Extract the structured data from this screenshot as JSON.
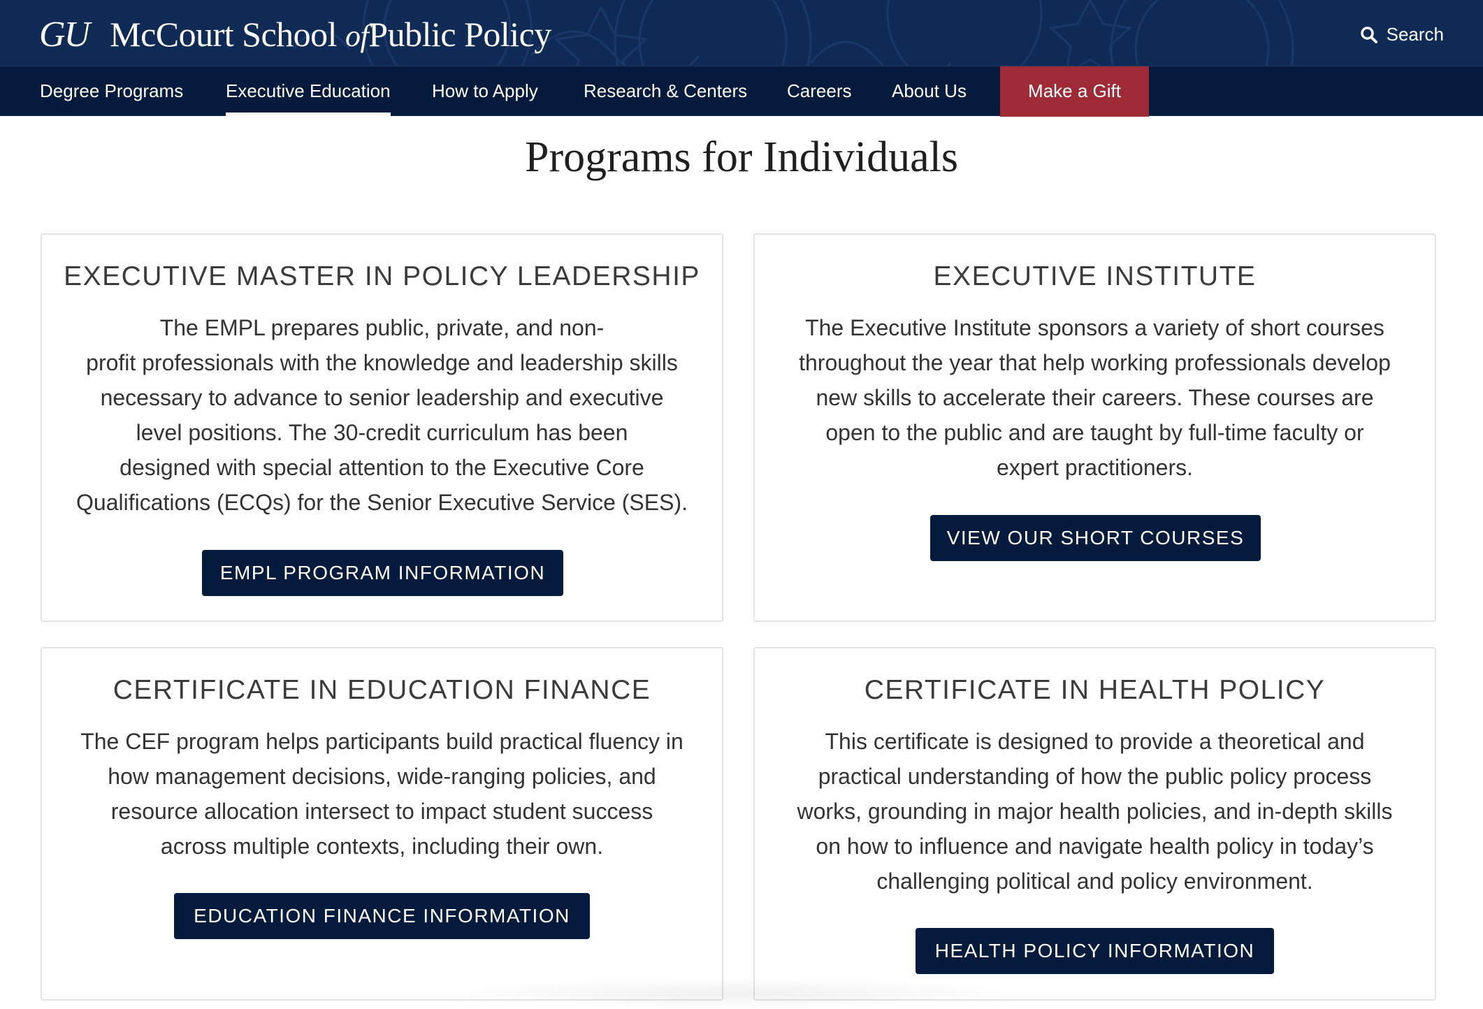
{
  "header": {
    "logo_mark": "GU",
    "school_name_part1": "McCourt School",
    "school_name_of": "of",
    "school_name_part2": "Public Policy",
    "search_label": "Search"
  },
  "nav": {
    "items": [
      {
        "label": "Degree Programs"
      },
      {
        "label": "Executive Education"
      },
      {
        "label": "How to Apply"
      },
      {
        "label": "Research & Centers"
      },
      {
        "label": "Careers"
      },
      {
        "label": "About Us"
      }
    ],
    "active": "Executive Education",
    "gift_label": "Make a Gift"
  },
  "page": {
    "title": "Programs for Individuals"
  },
  "cards": [
    {
      "title": "EXECUTIVE MASTER IN POLICY LEADERSHIP",
      "lines": [
        "The EMPL prepares public, private, and non-",
        "profit professionals with the knowledge and leadership skills",
        "necessary to advance to senior leadership and executive",
        "level positions. The 30-credit curriculum has been",
        "designed with special attention to the Executive Core",
        "Qualifications (ECQs) for the Senior Executive Service (SES)."
      ],
      "button": "EMPL PROGRAM INFORMATION"
    },
    {
      "title": "EXECUTIVE INSTITUTE",
      "lines": [
        "The Executive Institute sponsors a variety of short courses",
        "throughout the year that help working professionals develop",
        "new skills to accelerate their careers. These courses are",
        "open to the public and are taught by full-time faculty or",
        "expert practitioners."
      ],
      "button": "VIEW OUR SHORT COURSES"
    },
    {
      "title": "CERTIFICATE IN EDUCATION FINANCE",
      "lines": [
        "The CEF program helps participants build practical fluency in",
        "how management decisions, wide-ranging policies, and",
        "resource allocation intersect to impact student success",
        "across multiple contexts, including their own."
      ],
      "button": "EDUCATION FINANCE INFORMATION"
    },
    {
      "title": "CERTIFICATE IN HEALTH POLICY",
      "lines": [
        "This certificate is designed to provide a theoretical and",
        "practical understanding of how the public policy process",
        "works, grounding in major health policies, and in-depth skills",
        "on how to influence and navigate health policy in today’s",
        "challenging political and policy environment."
      ],
      "button": "HEALTH POLICY INFORMATION"
    }
  ],
  "colors": {
    "header_bg": "#0e2a55",
    "nav_bg": "#051b3d",
    "gift_bg": "#9e2a36",
    "button_bg": "#051b3d"
  },
  "icons": {
    "search": "search-icon"
  }
}
